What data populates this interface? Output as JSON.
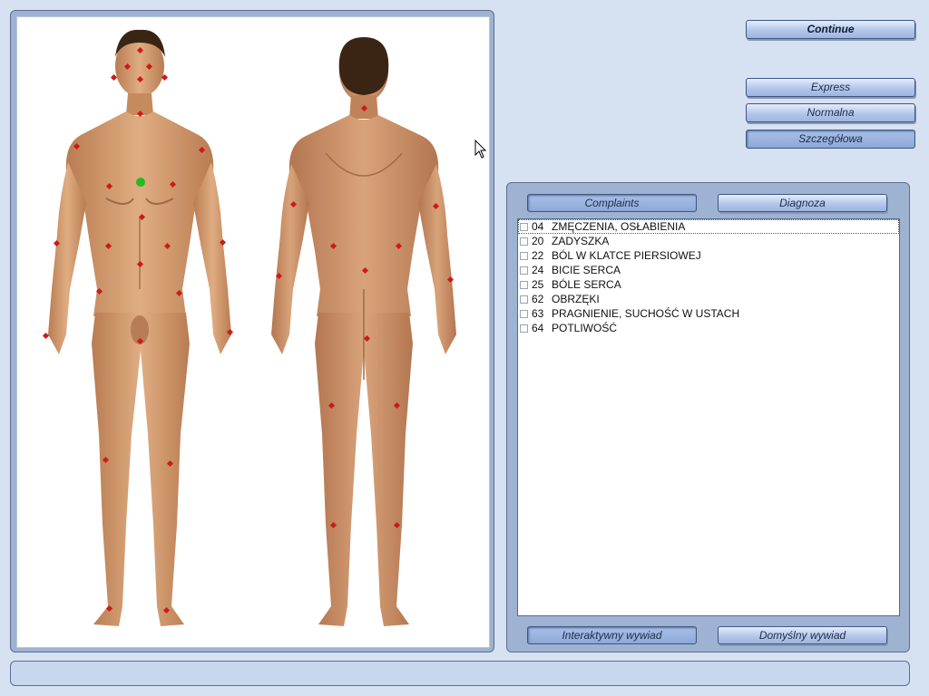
{
  "buttons": {
    "continue": "Continue",
    "express": "Express",
    "normalna": "Normalna",
    "szczegolowa": "Szczegółowa",
    "complaints": "Complaints",
    "diagnoza": "Diagnoza",
    "interaktywny": "Interaktywny wywiad",
    "domyslny": "Domyślny wywiad"
  },
  "complaints": [
    {
      "code": "04",
      "label": "ZMĘCZENIA, OSŁABIENIA",
      "checked": false
    },
    {
      "code": "20",
      "label": "ZADYSZKA",
      "checked": false
    },
    {
      "code": "22",
      "label": "BÓL W KLATCE PIERSIOWEJ",
      "checked": false
    },
    {
      "code": "24",
      "label": "BICIE SERCA",
      "checked": false
    },
    {
      "code": "25",
      "label": "BÓLE SERCA",
      "checked": false
    },
    {
      "code": "62",
      "label": "OBRZĘKI",
      "checked": false
    },
    {
      "code": "63",
      "label": "PRAGNIENIE, SUCHOŚĆ W USTACH",
      "checked": false
    },
    {
      "code": "64",
      "label": "POTLIWOŚĆ",
      "checked": false
    }
  ],
  "colors": {
    "point": "#cc1a1a",
    "selected_point": "#22bb22",
    "skin": "#d29a6c",
    "hair": "#3a2414"
  }
}
